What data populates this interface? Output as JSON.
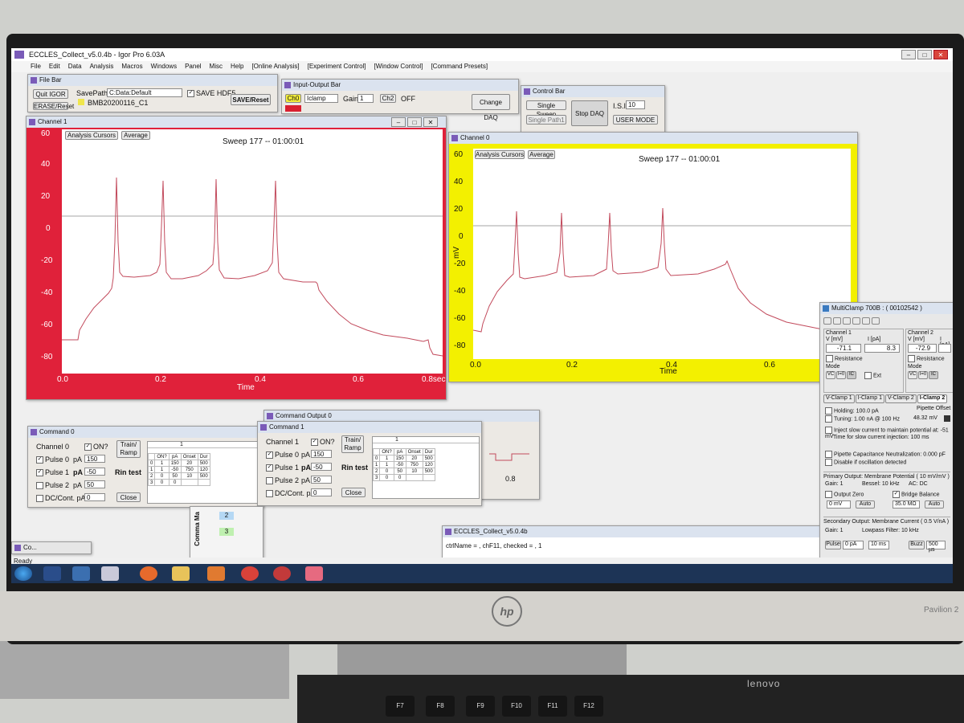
{
  "window": {
    "title": "ECCLES_Collect_v5.0.4b - Igor Pro 6.03A",
    "status": "Ready"
  },
  "menu": [
    "File",
    "Edit",
    "Data",
    "Analysis",
    "Macros",
    "Windows",
    "Panel",
    "Misc",
    "Help",
    "[Online Analysis]",
    "[Experiment Control]",
    "[Window Control]",
    "[Command Presets]"
  ],
  "file_bar": {
    "title": "File Bar",
    "quit": "Quit IGOR",
    "erase": "ERASE/Reset",
    "savepath_label": "SavePath",
    "savepath_value": "C:Data:Default",
    "save_hdf5": "SAVE HDF5",
    "save_reset": "SAVE/Reset",
    "file1": "BMB20200116_C1"
  },
  "io_bar": {
    "title": "Input-Output Bar",
    "ch0": "Ch0",
    "mode": "Iclamp",
    "gain_label": "Gain",
    "gain_value": "1",
    "ch2": "Ch2",
    "ch2_state": "OFF",
    "change_daq": "Change DAQ"
  },
  "control_bar": {
    "title": "Control Bar",
    "single_sweep": "Single Sweep",
    "stop_daq": "Stop DAQ",
    "isi_label": "I.S.I.",
    "isi_value": "10",
    "single_path": "Single Path1",
    "user_mode": "USER MODE"
  },
  "channel1": {
    "title": "Channel 1",
    "analysis_cursors": "Analysis Cursors",
    "average": "Average",
    "sweep": "Sweep 177 -- 01:00:01",
    "xlabel": "Time",
    "yticks": [
      "60",
      "40",
      "20",
      "0",
      "-20",
      "-40",
      "-60",
      "-80"
    ],
    "xticks": [
      "0.0",
      "0.2",
      "0.4",
      "0.6",
      "0.8sec"
    ]
  },
  "channel0": {
    "title": "Channel 0",
    "analysis_cursors": "Analysis Cursors",
    "average": "Average",
    "sweep": "Sweep 177 -- 01:00:01",
    "xlabel": "Time",
    "ylabel": "mV",
    "yticks": [
      "60",
      "40",
      "20",
      "0",
      "-20",
      "-40",
      "-60",
      "-80"
    ],
    "xticks": [
      "0.0",
      "0.2",
      "0.4",
      "0.6"
    ]
  },
  "command0": {
    "title": "Command 0",
    "channel": "Channel 0",
    "on": "ON?",
    "train": "Train/ Ramp",
    "pulse0": "Pulse 0",
    "pulse0_unit": "pA",
    "pulse0_val": "150",
    "pulse1": "Pulse 1",
    "pulse1_unit": "pA",
    "pulse1_val": "-50",
    "rin": "Rin test",
    "pulse2": "Pulse 2",
    "pulse2_unit": "pA",
    "pulse2_val": "50",
    "dc": "DC/Cont. pA",
    "dc_val": "0",
    "close": "Close",
    "table_head": [
      "ON?",
      "pA",
      "Onset",
      "Dur"
    ],
    "table_rows": [
      [
        "0",
        "1",
        "150",
        "20",
        "500"
      ],
      [
        "1",
        "1",
        "-50",
        "750",
        "120"
      ],
      [
        "2",
        "0",
        "50",
        "10",
        "500"
      ],
      [
        "3",
        "0",
        "0",
        "",
        ""
      ]
    ],
    "table_title": "1"
  },
  "command1": {
    "title": "Command 1",
    "channel": "Channel 1",
    "on": "ON?",
    "train": "Train/ Ramp",
    "pulse0": "Pulse 0",
    "pulse0_unit": "pA",
    "pulse0_val": "150",
    "pulse1": "Pulse 1",
    "pulse1_unit": "pA",
    "pulse1_val": "-50",
    "rin": "Rin test",
    "pulse2": "Pulse 2",
    "pulse2_unit": "pA",
    "pulse2_val": "50",
    "dc": "DC/Cont. pA",
    "dc_val": "0",
    "close": "Close",
    "table_head": [
      "ON?",
      "pA",
      "Onset",
      "Dur"
    ],
    "table_rows": [
      [
        "0",
        "1",
        "150",
        "20",
        "500"
      ],
      [
        "1",
        "1",
        "-50",
        "750",
        "120"
      ],
      [
        "2",
        "0",
        "50",
        "10",
        "500"
      ],
      [
        "3",
        "0",
        "0",
        "",
        ""
      ]
    ],
    "table_title": "1"
  },
  "command_output": {
    "title": "Command Output 0",
    "tick": "0.8",
    "side_label": "Comma Ma",
    "badge2": "2",
    "badge3": "3"
  },
  "eccles_window": {
    "title": "ECCLES_Collect_v5.0.4b",
    "text": "ctrlName = , chF11, checked = , 1"
  },
  "minimized": {
    "label": "Co..."
  },
  "multiclamp": {
    "title": "MultiClamp 700B : ( 00102542 )",
    "ch1_title": "Channel 1",
    "ch1_v_label": "V [mV]",
    "ch1_i_label": "I [pA]",
    "ch1_v": "-71.1",
    "ch1_i": "8.3",
    "ch2_title": "Channel 2",
    "ch2_v_label": "V [mV]",
    "ch2_i_label": "I [pA]",
    "ch2_v": "-72.9",
    "ch2_i": "",
    "resistance": "Resistance",
    "mode": "Mode",
    "vc": "VC",
    "i0": "I=0",
    "ic": "IC",
    "ext": "Ext",
    "tabs": [
      "V-Clamp 1",
      "I-Clamp 1",
      "V-Clamp 2",
      "I-Clamp 2"
    ],
    "holding": "Holding: 100.0 pA",
    "tuning": "Tuning: 1.00 nA @ 100 Hz",
    "pipette_offset": "Pipette Offset",
    "pipette_offset_val": "48.32 mV",
    "inject": "Inject slow current to maintain potential at: -51 mV",
    "time_slow": "Time for slow current injection: 100 ms",
    "pipette_cap": "Pipette Capacitance Neutralization: 0.000 pF",
    "disable_osc": "Disable if oscillation detected",
    "primary": "Primary Output: Membrane Potential ( 10 mV/mV )",
    "gain": "Gain: 1",
    "bessel": "Bessel: 10 kHz",
    "ac": "AC: DC",
    "output_zero": "Output Zero",
    "bridge": "Bridge Balance",
    "zero_val": "0 mV",
    "bridge_val": "35.0 MΩ",
    "auto": "Auto",
    "secondary": "Secondary Output: Membrane Current ( 0.5 V/nA )",
    "gain2": "Gain: 1",
    "lowpass": "Lowpass Filter: 10 kHz",
    "pulse": "Pulse",
    "pulse_val": "0 pA",
    "pulse_ms": "10 ms",
    "buzz": "Buzz",
    "buzz_val": "500 µs"
  },
  "hardware": {
    "keyboard_brand": "lenovo",
    "monitor_model": "Pavilion 2",
    "fkeys": [
      "F7",
      "F8",
      "F9",
      "F10",
      "F11",
      "F12"
    ]
  }
}
